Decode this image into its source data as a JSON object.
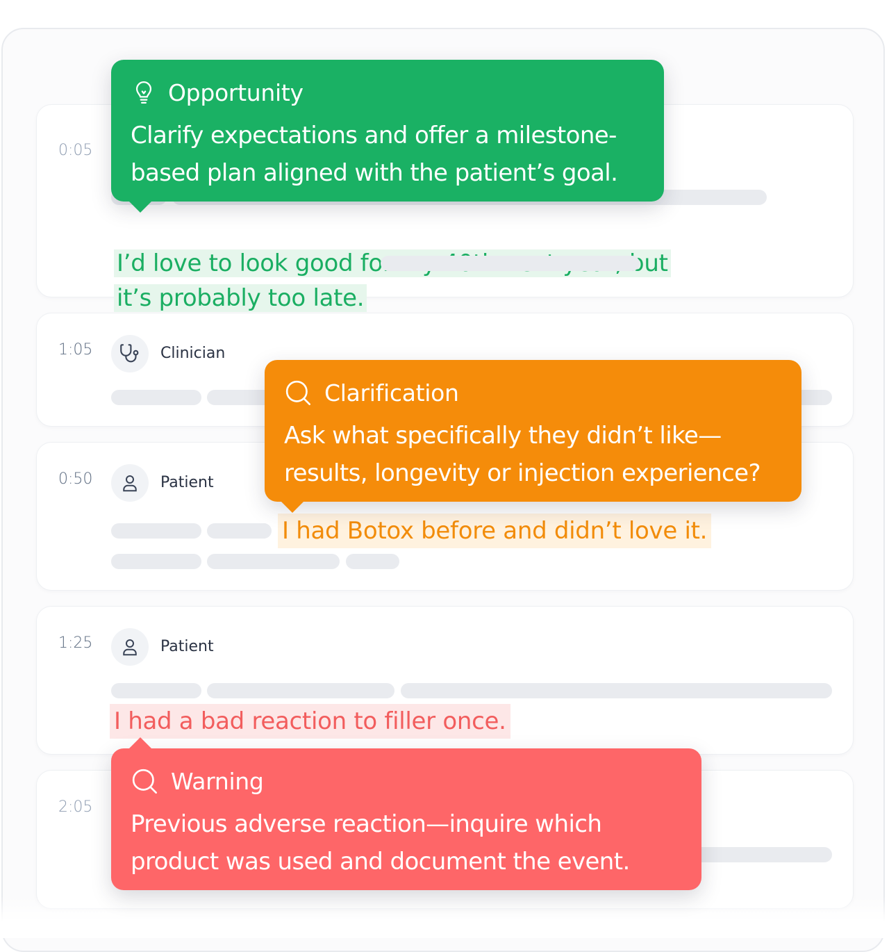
{
  "rows": [
    {
      "time": "0:05",
      "quote": "I’d love to look good for my 40th next year, but\nit’s probably too late."
    },
    {
      "time": "1:05",
      "speaker": "Clinician"
    },
    {
      "time": "0:50",
      "speaker": "Patient",
      "quote": "I had Botox before and didn’t love it."
    },
    {
      "time": "1:25",
      "speaker": "Patient",
      "quote": "I had a bad reaction to filler once."
    },
    {
      "time": "2:05"
    }
  ],
  "callouts": {
    "opportunity": {
      "title": "Opportunity",
      "icon": "lightbulb-icon",
      "color": "#1ab164",
      "text": "Clarify expectations and offer a milestone-\nbased plan aligned with the patient’s goal."
    },
    "clarification": {
      "title": "Clarification",
      "icon": "search-icon",
      "color": "#f58c0a",
      "text": "Ask what specifically they didn’t like—\nresults, longevity or injection experience?"
    },
    "warning": {
      "title": "Warning",
      "icon": "search-icon",
      "color": "#fe6668",
      "text": "Previous adverse reaction—inquire which\nproduct was used and document the event."
    }
  }
}
